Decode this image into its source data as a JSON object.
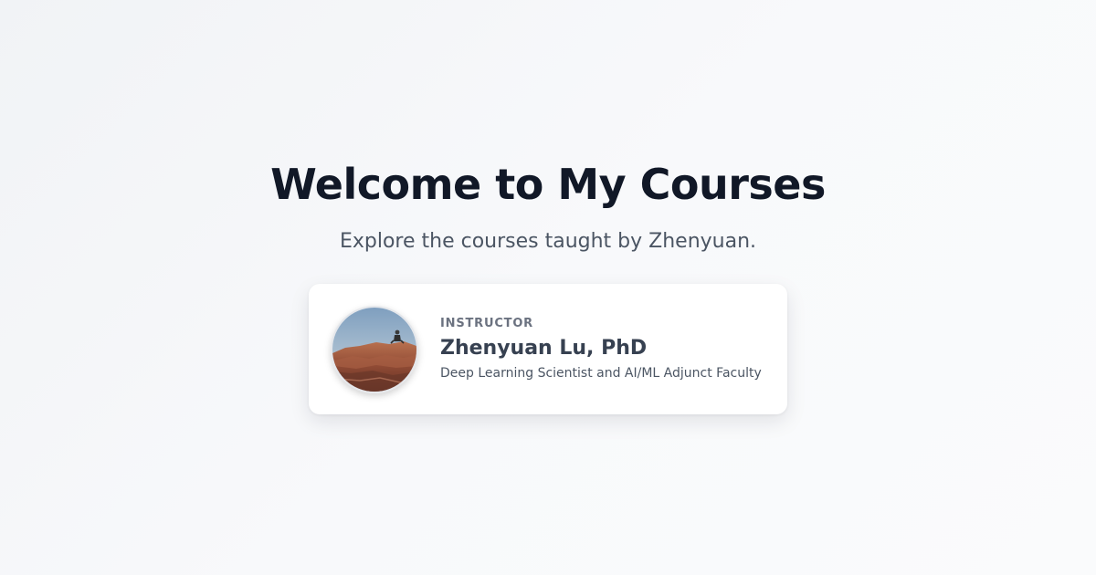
{
  "hero": {
    "title": "Welcome to My Courses",
    "subtitle": "Explore the courses taught by Zhenyuan."
  },
  "instructor_card": {
    "role_label": "INSTRUCTOR",
    "name": "Zhenyuan Lu, PhD",
    "description": "Deep Learning Scientist and AI/ML Adjunct Faculty",
    "avatar_icon": "profile-photo-person-on-red-rocks"
  },
  "colors": {
    "background": "#f5f6f8",
    "title": "#111827",
    "subtitle": "#4b5563",
    "card_background": "#ffffff",
    "role_label": "#6b7280",
    "name": "#374151"
  }
}
